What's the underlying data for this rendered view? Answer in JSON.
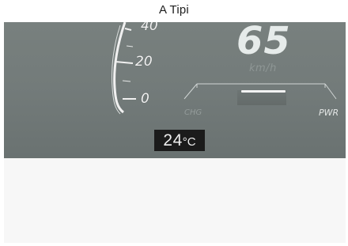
{
  "caption": "A Tipi",
  "cluster": {
    "gauge_ticks": [
      "40",
      "20",
      "0"
    ],
    "speed": {
      "value": "65",
      "unit": "km/h"
    },
    "power_meter": {
      "left_label": "CHG",
      "right_label": "PWR"
    },
    "temperature": {
      "value": "24",
      "unit": "°C"
    }
  }
}
